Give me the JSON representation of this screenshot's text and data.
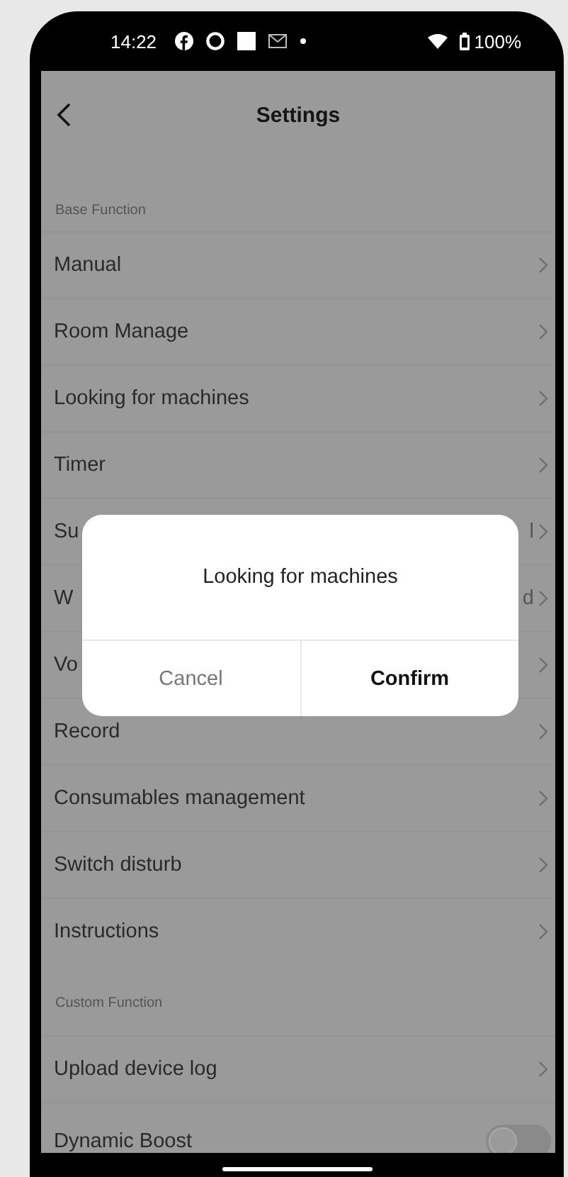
{
  "status_bar": {
    "time": "14:22",
    "battery": "100%"
  },
  "header": {
    "title": "Settings"
  },
  "sections": [
    {
      "title": "Base Function",
      "items": [
        {
          "kind": "link",
          "label": "Manual"
        },
        {
          "kind": "link",
          "label": "Room Manage"
        },
        {
          "kind": "link",
          "label": "Looking for machines"
        },
        {
          "kind": "link",
          "label": "Timer"
        },
        {
          "kind": "link",
          "label": "Su",
          "value": "l"
        },
        {
          "kind": "link",
          "label": "W",
          "value": "d"
        },
        {
          "kind": "link",
          "label": "Vo"
        },
        {
          "kind": "link",
          "label": "Record"
        },
        {
          "kind": "link",
          "label": "Consumables management"
        },
        {
          "kind": "link",
          "label": "Switch disturb"
        },
        {
          "kind": "link",
          "label": "Instructions"
        }
      ]
    },
    {
      "title": "Custom Function",
      "items": [
        {
          "kind": "link",
          "label": "Upload device log"
        },
        {
          "kind": "toggle",
          "label": "Dynamic Boost",
          "on": false
        }
      ]
    }
  ],
  "dialog": {
    "title": "Looking for machines",
    "buttons": [
      {
        "label": "Cancel",
        "kind": "cancel"
      },
      {
        "label": "Confirm",
        "kind": "confirm"
      }
    ]
  }
}
